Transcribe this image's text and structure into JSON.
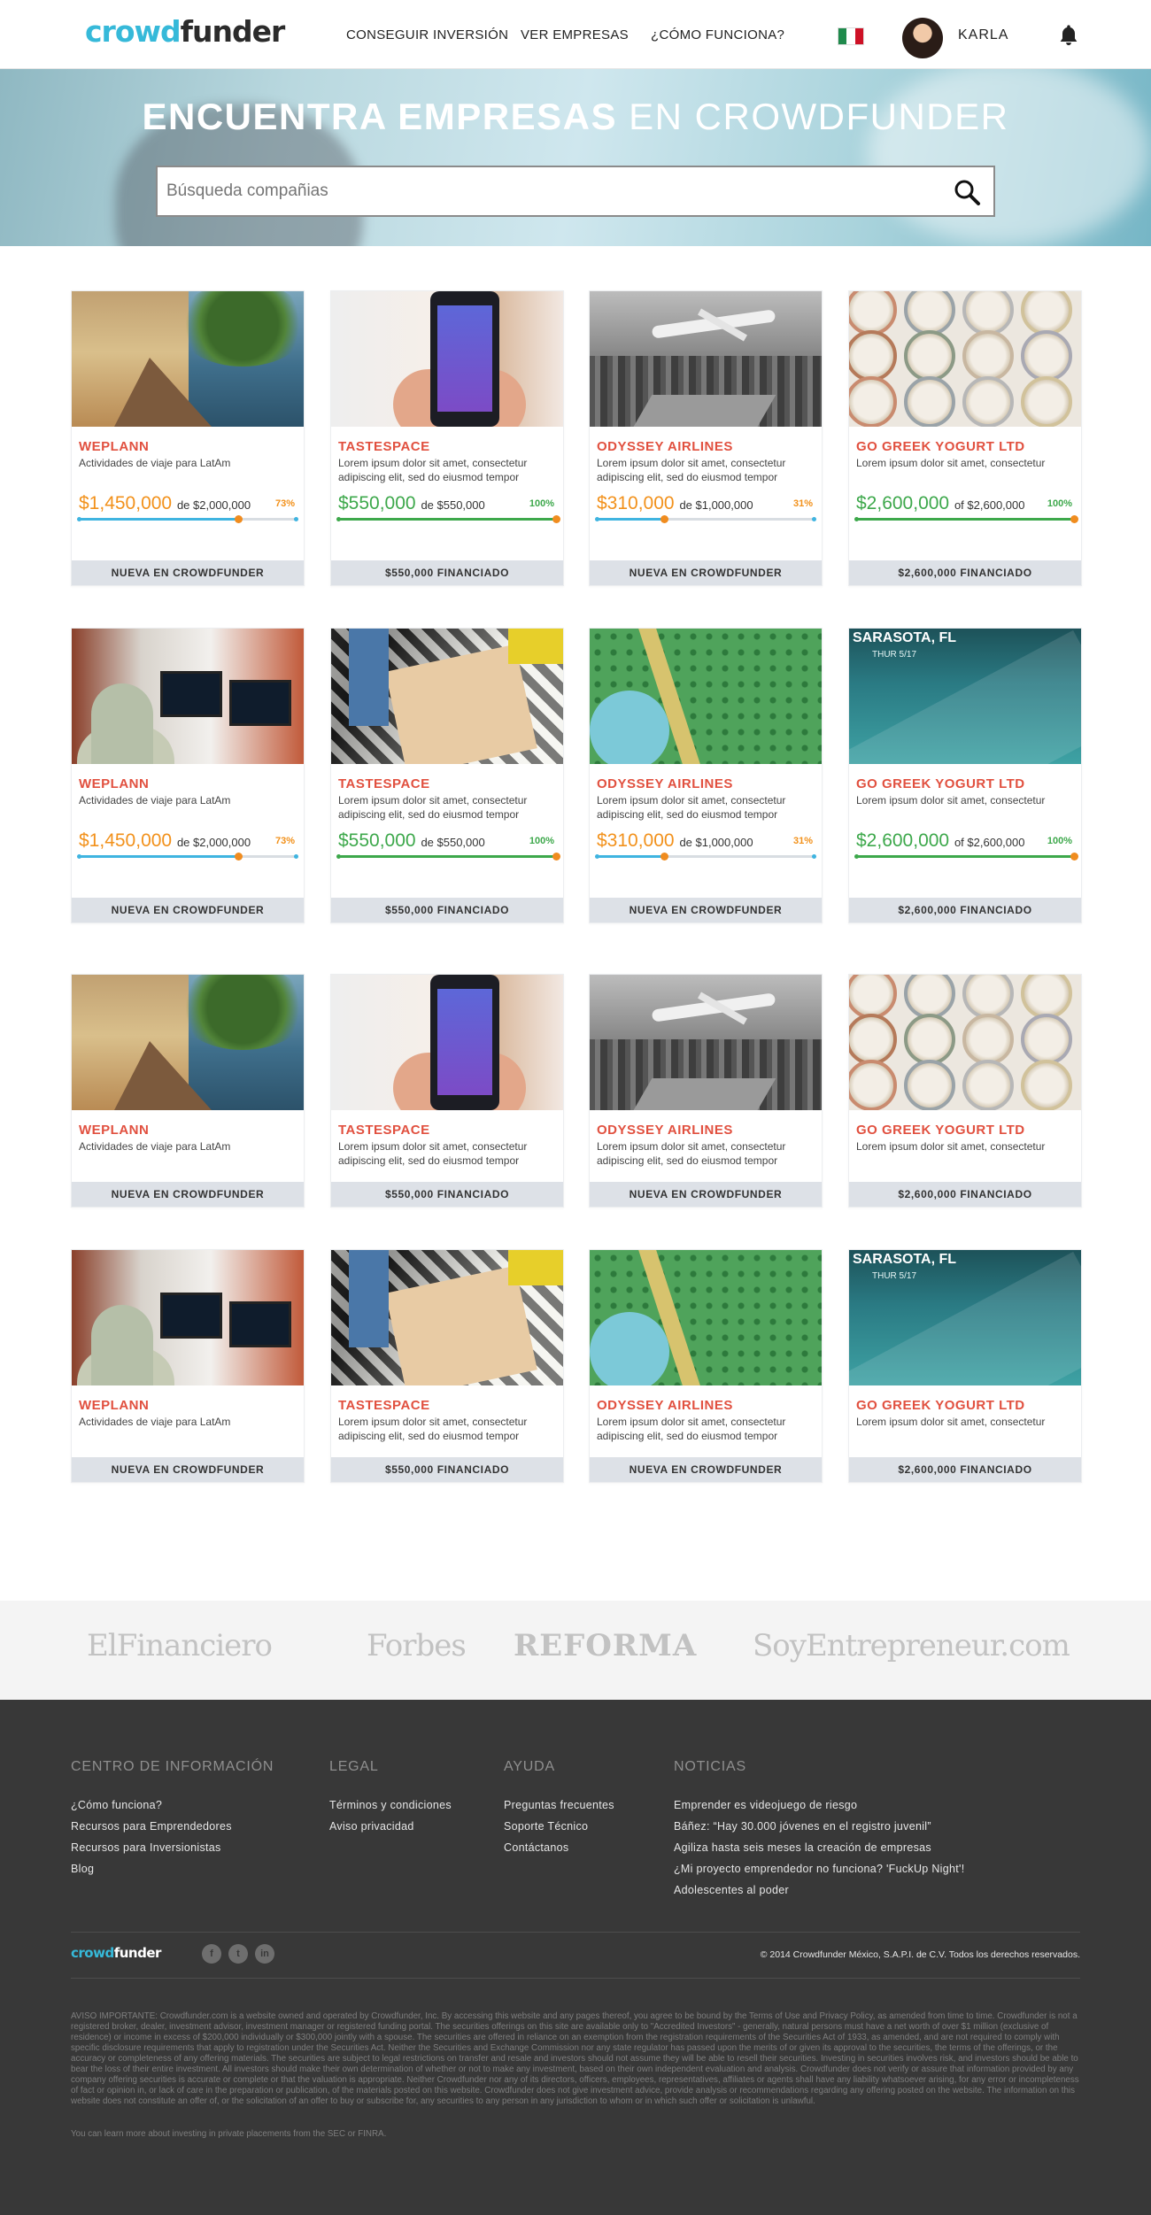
{
  "header": {
    "logo_part1": "crowd",
    "logo_part2": "funder",
    "nav": [
      "CONSEGUIR INVERSIÓN",
      "VER EMPRESAS",
      "¿CÓMO FUNCIONA?"
    ],
    "username": "KARLA"
  },
  "hero": {
    "title_bold": "ENCUENTRA EMPRESAS",
    "title_light": " EN CROWDFUNDER",
    "search_placeholder": "Búsqueda compañias"
  },
  "colors": {
    "brand": "#36b9d9",
    "accent_red": "#e1503f",
    "orange": "#f2911b",
    "green": "#3da84b",
    "footer_bg": "#383838"
  },
  "cards": [
    {
      "name": "WEPLANN",
      "desc": "Actividades de viaje para LatAm",
      "raised": "$1,450,000",
      "goal": "de $2,000,000",
      "pct": "73%",
      "progress": 0.73,
      "color": "orange",
      "status": "NUEVA EN CROWDFUNDER",
      "img": "pier"
    },
    {
      "name": "TASTESPACE",
      "desc": "Lorem ipsum dolor sit amet, consectetur adipiscing elit, sed do eiusmod tempor",
      "raised": "$550,000",
      "goal": "de $550,000",
      "pct": "100%",
      "progress": 1.0,
      "color": "green",
      "status": "$550,000 FINANCIADO",
      "img": "phone"
    },
    {
      "name": "ODYSSEY AIRLINES",
      "desc": "Lorem ipsum dolor sit amet, consectetur adipiscing elit, sed do eiusmod tempor",
      "raised": "$310,000",
      "goal": "de $1,000,000",
      "pct": "31%",
      "progress": 0.31,
      "color": "orange",
      "status": "NUEVA EN CROWDFUNDER",
      "img": "plane"
    },
    {
      "name": "GO GREEK YOGURT LTD",
      "desc": "Lorem ipsum dolor sit amet, consectetur",
      "raised": "$2,600,000",
      "goal": "of $2,600,000",
      "pct": "100%",
      "progress": 1.0,
      "color": "green",
      "status": "$2,600,000 FINANCIADO",
      "img": "yog"
    },
    {
      "name": "WEPLANN",
      "desc": "Actividades de viaje para LatAm",
      "raised": "$1,450,000",
      "goal": "de $2,000,000",
      "pct": "73%",
      "progress": 0.73,
      "color": "orange",
      "status": "NUEVA EN CROWDFUNDER",
      "img": "office"
    },
    {
      "name": "TASTESPACE",
      "desc": "Lorem ipsum dolor sit amet, consectetur adipiscing elit, sed do eiusmod tempor",
      "raised": "$550,000",
      "goal": "de $550,000",
      "pct": "100%",
      "progress": 1.0,
      "color": "green",
      "status": "$550,000 FINANCIADO",
      "img": "toys"
    },
    {
      "name": "ODYSSEY AIRLINES",
      "desc": "Lorem ipsum dolor sit amet, consectetur adipiscing elit, sed do eiusmod tempor",
      "raised": "$310,000",
      "goal": "de $1,000,000",
      "pct": "31%",
      "progress": 0.31,
      "color": "orange",
      "status": "NUEVA EN CROWDFUNDER",
      "img": "map"
    },
    {
      "name": "GO GREEK YOGURT LTD",
      "desc": "Lorem ipsum dolor sit amet, consectetur",
      "raised": "$2,600,000",
      "goal": "of $2,600,000",
      "pct": "100%",
      "progress": 1.0,
      "color": "green",
      "status": "$2,600,000 FINANCIADO",
      "img": "weather"
    },
    {
      "name": "WEPLANN",
      "desc": "Actividades de viaje para LatAm",
      "status": "NUEVA EN CROWDFUNDER",
      "img": "pier"
    },
    {
      "name": "TASTESPACE",
      "desc": "Lorem ipsum dolor sit amet, consectetur adipiscing elit, sed do eiusmod tempor",
      "status": "$550,000 FINANCIADO",
      "img": "phone"
    },
    {
      "name": "ODYSSEY AIRLINES",
      "desc": "Lorem ipsum dolor sit amet, consectetur adipiscing elit, sed do eiusmod tempor",
      "status": "NUEVA EN CROWDFUNDER",
      "img": "plane"
    },
    {
      "name": "GO GREEK YOGURT LTD",
      "desc": "Lorem ipsum dolor sit amet, consectetur",
      "status": "$2,600,000 FINANCIADO",
      "img": "yog"
    },
    {
      "name": "WEPLANN",
      "desc": "Actividades de viaje para LatAm",
      "status": "NUEVA EN CROWDFUNDER",
      "img": "office"
    },
    {
      "name": "TASTESPACE",
      "desc": "Lorem ipsum dolor sit amet, consectetur adipiscing elit, sed do eiusmod tempor",
      "status": "$550,000 FINANCIADO",
      "img": "toys"
    },
    {
      "name": "ODYSSEY AIRLINES",
      "desc": "Lorem ipsum dolor sit amet, consectetur adipiscing elit, sed do eiusmod tempor",
      "status": "NUEVA EN CROWDFUNDER",
      "img": "map"
    },
    {
      "name": "GO GREEK YOGURT LTD",
      "desc": "Lorem ipsum dolor sit amet, consectetur",
      "status": "$2,600,000 FINANCIADO",
      "img": "weather"
    }
  ],
  "weather_card": {
    "city": "SARASOTA, FL",
    "date": "THUR 5/17"
  },
  "press": [
    "ElFinanciero",
    "Forbes",
    "REFORMA",
    "SoyEntrepreneur.com"
  ],
  "footer": {
    "columns": [
      {
        "title": "CENTRO DE INFORMACIÓN",
        "links": [
          "¿Cómo funciona?",
          "Recursos para Emprendedores",
          "Recursos para Inversionistas",
          "Blog"
        ]
      },
      {
        "title": "LEGAL",
        "links": [
          "Términos y condiciones",
          "Aviso privacidad"
        ]
      },
      {
        "title": "AYUDA",
        "links": [
          "Preguntas frecuentes",
          "Soporte Técnico",
          "Contáctanos"
        ]
      },
      {
        "title": "NOTICIAS",
        "links": [
          "Emprender es videojuego de riesgo",
          "Báñez: “Hay 30.000 jóvenes en el registro juvenil”",
          "Agiliza hasta seis meses la creación de empresas",
          "¿Mi proyecto emprendedor no funciona? 'FuckUp Night'!",
          "Adolescentes al poder"
        ]
      }
    ],
    "logo_part1": "crowd",
    "logo_part2": "funder",
    "social": [
      "f",
      "t",
      "in"
    ],
    "copyright": "© 2014 Crowdfunder México, S.A.P.I. de C.V. Todos los derechos reservados.",
    "disclaimer": "AVISO IMPORTANTE: Crowdfunder.com is a website owned and operated by Crowdfunder, Inc. By accessing this website and any pages thereof, you agree to be bound by the Terms of Use and Privacy Policy, as amended from time to time. Crowdfunder is not a registered broker, dealer, investment advisor, investment manager or registered funding portal. The securities offerings on this site are available only to \"Accredited Investors\" - generally, natural persons must have a net worth of over $1 million (exclusive of residence) or income in excess of $200,000 individually or $300,000 jointly with a spouse. The securities are offered in reliance on an exemption from the registration requirements of the Securities Act of 1933, as amended, and are not required to comply with specific disclosure requirements that apply to registration under the Securities Act. Neither the Securities and Exchange Commission nor any state regulator has passed upon the merits of or given its approval to the securities, the terms of the offerings, or the accuracy or completeness of any offering materials. The securities are subject to legal restrictions on transfer and resale and investors should not assume they will be able to resell their securities. Investing in securities involves risk, and investors should be able to bear the loss of their entire investment. All investors should make their own determination of whether or not to make any investment, based on their own independent evaluation and analysis. Crowdfunder does not verify or assure that information provided by any company offering securities is accurate or complete or that the valuation is appropriate. Neither Crowdfunder nor any of its directors, officers, employees, representatives, affiliates or agents shall have any liability whatsoever arising, for any error or incompleteness of fact or opinion in, or lack of care in the preparation or publication, of the materials posted on this website. Crowdfunder does not give investment advice, provide analysis or recommendations regarding any offering posted on the website. The information on this website does not constitute an offer of, or the solicitation of an offer to buy or subscribe for, any securities to any person in any jurisdiction to whom or in which such offer or solicitation is unlawful.",
    "learn_more": "You can learn more about investing in private placements from the SEC or FINRA."
  }
}
